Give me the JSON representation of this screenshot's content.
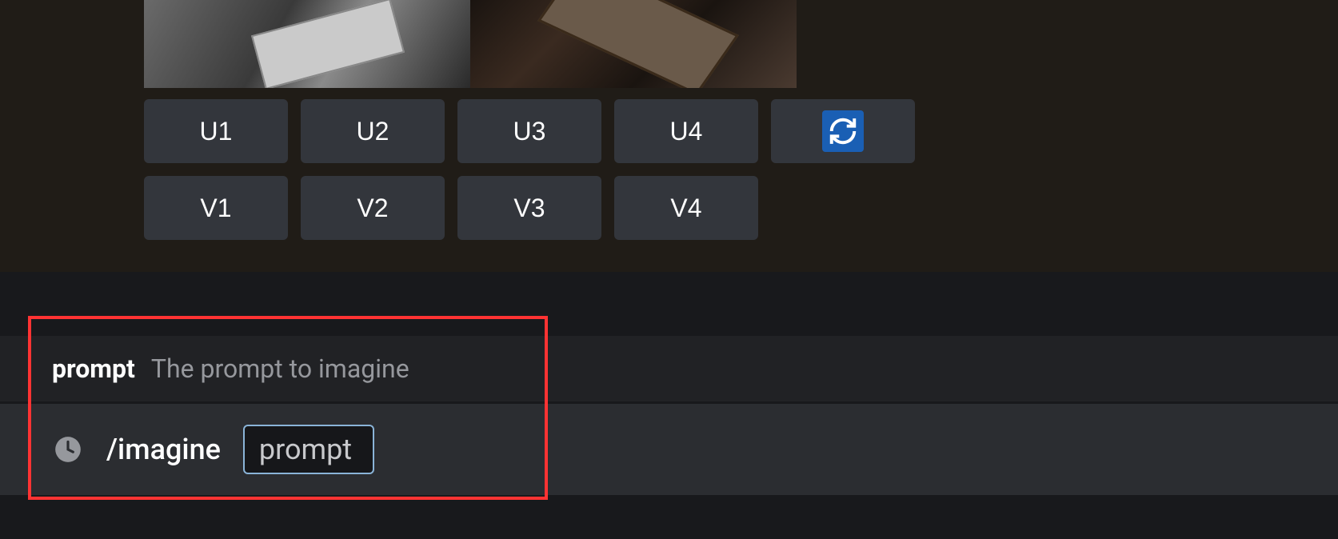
{
  "buttons": {
    "upscale": [
      "U1",
      "U2",
      "U3",
      "U4"
    ],
    "variation": [
      "V1",
      "V2",
      "V3",
      "V4"
    ]
  },
  "promptHint": {
    "label": "prompt",
    "description": "The prompt to imagine"
  },
  "command": {
    "text": "/imagine",
    "param": "prompt"
  }
}
